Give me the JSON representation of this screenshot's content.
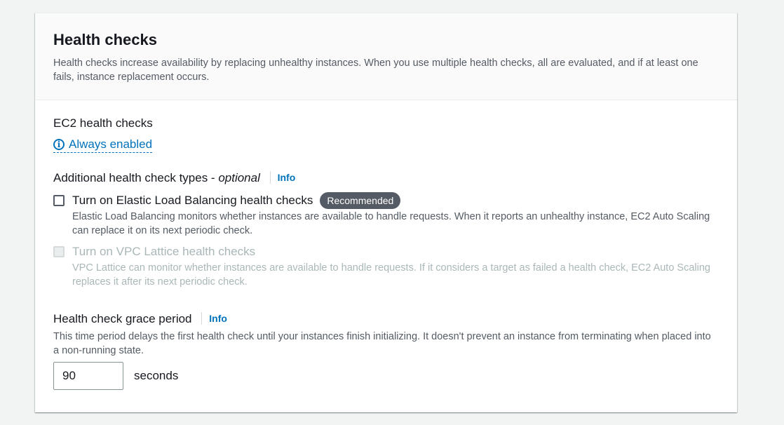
{
  "header": {
    "title": "Health checks",
    "description": "Health checks increase availability by replacing unhealthy instances. When you use multiple health checks, all are evaluated, and if at least one fails, instance replacement occurs."
  },
  "ec2": {
    "label": "EC2 health checks",
    "status": "Always enabled",
    "status_icon": "info-icon"
  },
  "additional": {
    "label_main": "Additional health check types - ",
    "label_optional": "optional",
    "info_label": "Info",
    "options": [
      {
        "label": "Turn on Elastic Load Balancing health checks",
        "badge": "Recommended",
        "description": "Elastic Load Balancing monitors whether instances are available to handle requests. When it reports an unhealthy instance, EC2 Auto Scaling can replace it on its next periodic check.",
        "checked": false,
        "disabled": false
      },
      {
        "label": "Turn on VPC Lattice health checks",
        "description": "VPC Lattice can monitor whether instances are available to handle requests. If it considers a target as failed a health check, EC2 Auto Scaling replaces it after its next periodic check.",
        "checked": false,
        "disabled": true
      }
    ]
  },
  "grace": {
    "label": "Health check grace period",
    "info_label": "Info",
    "description": "This time period delays the first health check until your instances finish initializing. It doesn't prevent an instance from terminating when placed into a non-running state.",
    "value": "90",
    "unit": "seconds"
  },
  "colors": {
    "link": "#0073bb",
    "badge_bg": "#545b64",
    "disabled_text": "#aab7b8",
    "page_bg": "#f2f3f3"
  }
}
